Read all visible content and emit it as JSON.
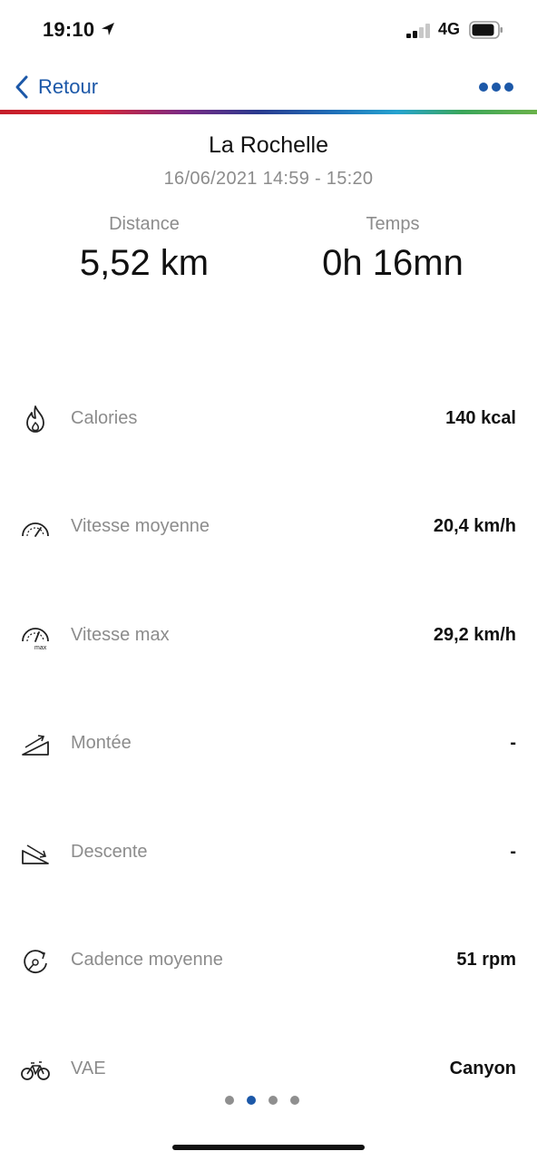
{
  "status_bar": {
    "time": "19:10",
    "network": "4G"
  },
  "nav": {
    "back_label": "Retour"
  },
  "ride": {
    "title": "La Rochelle",
    "date_range": "16/06/2021 14:59 - 15:20"
  },
  "summary": {
    "distance": {
      "label": "Distance",
      "value": "5,52 km"
    },
    "time": {
      "label": "Temps",
      "value": "0h 16mn"
    }
  },
  "metrics": [
    {
      "icon": "flame-icon",
      "label": "Calories",
      "value": "140 kcal"
    },
    {
      "icon": "speedometer-icon",
      "label": "Vitesse moyenne",
      "value": "20,4 km/h"
    },
    {
      "icon": "speedometer-max-icon",
      "icon_text": "max",
      "label": "Vitesse max",
      "value": "29,2 km/h"
    },
    {
      "icon": "ascent-icon",
      "label": "Montée",
      "value": "-"
    },
    {
      "icon": "descent-icon",
      "label": "Descente",
      "value": "-"
    },
    {
      "icon": "cadence-icon",
      "label": "Cadence moyenne",
      "value": "51 rpm"
    },
    {
      "icon": "bicycle-icon",
      "label": "VAE",
      "value": "Canyon"
    }
  ],
  "pagination": {
    "pages": 4,
    "active_page": 2
  },
  "colors": {
    "accent": "#1c58a8",
    "muted_text": "#8c8c8c"
  }
}
